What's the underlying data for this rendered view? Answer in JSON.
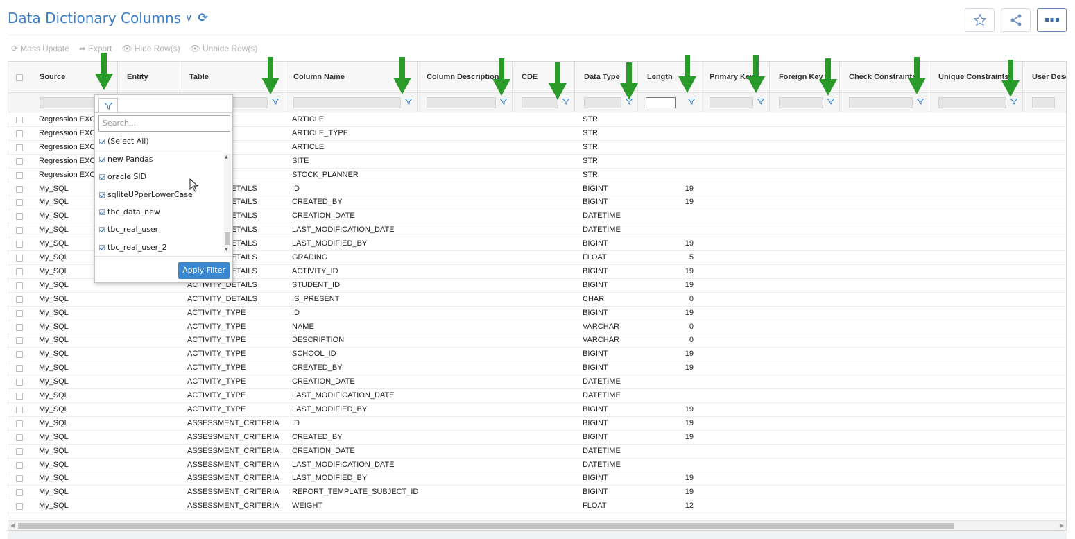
{
  "header": {
    "title": "Data Dictionary Columns",
    "favorite_icon": "star-icon",
    "share_icon": "share-icon",
    "more_icon": "more-icon"
  },
  "toolbar": {
    "mass_update": "Mass Update",
    "export": "Export",
    "hide_rows": "Hide Row(s)",
    "unhide_rows": "Unhide Row(s)"
  },
  "columns": [
    "Source",
    "Entity",
    "Table",
    "Column Name",
    "Column Description",
    "CDE",
    "Data Type",
    "Length",
    "Primary Key",
    "Foreign Key",
    "Check Constraints",
    "Unique Constraints",
    "User Descr"
  ],
  "rows": [
    {
      "source": "Regression EXCE",
      "table": "",
      "column": "ARTICLE",
      "type": "STR",
      "length": ""
    },
    {
      "source": "Regression EXCE",
      "table": "",
      "column": "ARTICLE_TYPE",
      "type": "STR",
      "length": ""
    },
    {
      "source": "Regression EXCE",
      "table": "",
      "column": "ARTICLE",
      "type": "STR",
      "length": ""
    },
    {
      "source": "Regression EXCE",
      "table": "",
      "column": "SITE",
      "type": "STR",
      "length": ""
    },
    {
      "source": "Regression EXCE",
      "table": "",
      "column": "STOCK_PLANNER",
      "type": "STR",
      "length": ""
    },
    {
      "source": "My_SQL",
      "table": "ACTIVITY_DETAILS",
      "column": "ID",
      "type": "BIGINT",
      "length": "19"
    },
    {
      "source": "My_SQL",
      "table": "ACTIVITY_DETAILS",
      "column": "CREATED_BY",
      "type": "BIGINT",
      "length": "19"
    },
    {
      "source": "My_SQL",
      "table": "ACTIVITY_DETAILS",
      "column": "CREATION_DATE",
      "type": "DATETIME",
      "length": ""
    },
    {
      "source": "My_SQL",
      "table": "ACTIVITY_DETAILS",
      "column": "LAST_MODIFICATION_DATE",
      "type": "DATETIME",
      "length": ""
    },
    {
      "source": "My_SQL",
      "table": "ACTIVITY_DETAILS",
      "column": "LAST_MODIFIED_BY",
      "type": "BIGINT",
      "length": "19"
    },
    {
      "source": "My_SQL",
      "table": "ACTIVITY_DETAILS",
      "column": "GRADING",
      "type": "FLOAT",
      "length": "5"
    },
    {
      "source": "My_SQL",
      "table": "ACTIVITY_DETAILS",
      "column": "ACTIVITY_ID",
      "type": "BIGINT",
      "length": "19"
    },
    {
      "source": "My_SQL",
      "table": "ACTIVITY_DETAILS",
      "column": "STUDENT_ID",
      "type": "BIGINT",
      "length": "19"
    },
    {
      "source": "My_SQL",
      "table": "ACTIVITY_DETAILS",
      "column": "IS_PRESENT",
      "type": "CHAR",
      "length": "0"
    },
    {
      "source": "My_SQL",
      "table": "ACTIVITY_TYPE",
      "column": "ID",
      "type": "BIGINT",
      "length": "19"
    },
    {
      "source": "My_SQL",
      "table": "ACTIVITY_TYPE",
      "column": "NAME",
      "type": "VARCHAR",
      "length": "0"
    },
    {
      "source": "My_SQL",
      "table": "ACTIVITY_TYPE",
      "column": "DESCRIPTION",
      "type": "VARCHAR",
      "length": "0"
    },
    {
      "source": "My_SQL",
      "table": "ACTIVITY_TYPE",
      "column": "SCHOOL_ID",
      "type": "BIGINT",
      "length": "19"
    },
    {
      "source": "My_SQL",
      "table": "ACTIVITY_TYPE",
      "column": "CREATED_BY",
      "type": "BIGINT",
      "length": "19"
    },
    {
      "source": "My_SQL",
      "table": "ACTIVITY_TYPE",
      "column": "CREATION_DATE",
      "type": "DATETIME",
      "length": ""
    },
    {
      "source": "My_SQL",
      "table": "ACTIVITY_TYPE",
      "column": "LAST_MODIFICATION_DATE",
      "type": "DATETIME",
      "length": ""
    },
    {
      "source": "My_SQL",
      "table": "ACTIVITY_TYPE",
      "column": "LAST_MODIFIED_BY",
      "type": "BIGINT",
      "length": "19"
    },
    {
      "source": "My_SQL",
      "table": "ASSESSMENT_CRITERIA",
      "column": "ID",
      "type": "BIGINT",
      "length": "19"
    },
    {
      "source": "My_SQL",
      "table": "ASSESSMENT_CRITERIA",
      "column": "CREATED_BY",
      "type": "BIGINT",
      "length": "19"
    },
    {
      "source": "My_SQL",
      "table": "ASSESSMENT_CRITERIA",
      "column": "CREATION_DATE",
      "type": "DATETIME",
      "length": ""
    },
    {
      "source": "My_SQL",
      "table": "ASSESSMENT_CRITERIA",
      "column": "LAST_MODIFICATION_DATE",
      "type": "DATETIME",
      "length": ""
    },
    {
      "source": "My_SQL",
      "table": "ASSESSMENT_CRITERIA",
      "column": "LAST_MODIFIED_BY",
      "type": "BIGINT",
      "length": "19"
    },
    {
      "source": "My_SQL",
      "table": "ASSESSMENT_CRITERIA",
      "column": "REPORT_TEMPLATE_SUBJECT_ID",
      "type": "BIGINT",
      "length": "19"
    },
    {
      "source": "My_SQL",
      "table": "ASSESSMENT_CRITERIA",
      "column": "WEIGHT",
      "type": "FLOAT",
      "length": "12"
    }
  ],
  "filter_popup": {
    "search_placeholder": "Search...",
    "select_all": "(Select All)",
    "items": [
      "new Pandas",
      "oracle SID",
      "sqliteUPperLowerCase",
      "tbc_data_new",
      "tbc_real_user",
      "tbc_real_user_2"
    ],
    "apply_label": "Apply Filter"
  },
  "colors": {
    "accent": "#3a7cc5",
    "arrow": "#2a9a2a",
    "apply_button": "#3a86cf"
  }
}
